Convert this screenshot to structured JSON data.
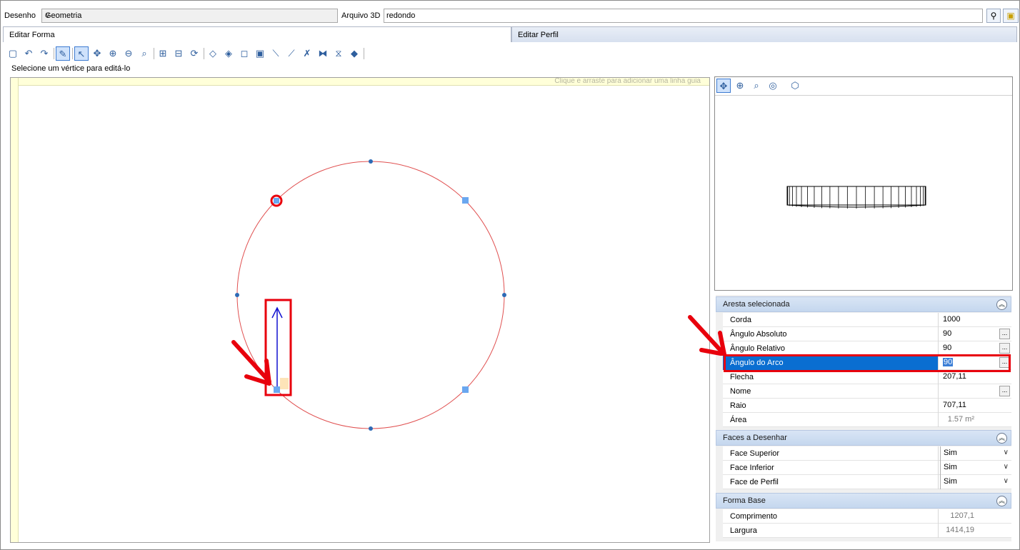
{
  "top": {
    "drawing_label": "Desenho",
    "drawing_value": "Geometria",
    "file3d_label": "Arquivo 3D",
    "file3d_value": "redondo"
  },
  "tabs": [
    {
      "label": "Editar Forma",
      "active": true
    },
    {
      "label": "Editar Perfil",
      "active": false
    }
  ],
  "toolbar_icons": [
    "new-icon",
    "undo-icon",
    "redo-icon",
    "edit-vertex-icon",
    "select-icon",
    "pan-icon",
    "zoom-in-icon",
    "zoom-out-icon",
    "zoom-fit-icon",
    "add-vertex-icon",
    "remove-vertex-icon",
    "rotate-icon",
    "shape1-icon",
    "shape2-icon",
    "shape3-icon",
    "shape4-icon",
    "shape5-icon",
    "shape6-icon",
    "dxf-icon",
    "mirror-icon",
    "stack-icon",
    "layers-icon"
  ],
  "status": "Selecione um vértice para editá-lo",
  "canvas": {
    "hint": "Clique e arraste para adicionar uma linha guia"
  },
  "preview_tools": [
    "pan-icon",
    "zoom-in-icon",
    "zoom-fit-icon",
    "orbit-icon",
    "view-cube-icon"
  ],
  "props": {
    "cat1": "Aresta selecionada",
    "rows1": [
      {
        "name": "Corda",
        "value": "1000",
        "btn": false
      },
      {
        "name": "Ângulo Absoluto",
        "value": "90",
        "btn": true
      },
      {
        "name": "Ângulo Relativo",
        "value": "90",
        "btn": true
      },
      {
        "name": "Ângulo do Arco",
        "value": "90",
        "btn": true
      },
      {
        "name": "Flecha",
        "value": "207,11",
        "btn": false
      },
      {
        "name": "Nome",
        "value": "",
        "btn": true
      },
      {
        "name": "Raio",
        "value": "707,11",
        "btn": false
      },
      {
        "name": "Área",
        "value": "1.57 m²",
        "btn": false
      }
    ],
    "cat2": "Faces a Desenhar",
    "rows2": [
      {
        "name": "Face Superior",
        "value": "Sim"
      },
      {
        "name": "Face Inferior",
        "value": "Sim"
      },
      {
        "name": "Face de Perfil",
        "value": "Sim"
      }
    ],
    "cat3": "Forma Base",
    "rows3": [
      {
        "name": "Comprimento",
        "value": "1207,1"
      },
      {
        "name": "Largura",
        "value": "1414,19"
      }
    ]
  },
  "colors": {
    "accent_red": "#e8000c",
    "selection_blue": "#0a6ed1",
    "circle_stroke": "#e05050",
    "vertex_blue": "#6aa7f0"
  }
}
